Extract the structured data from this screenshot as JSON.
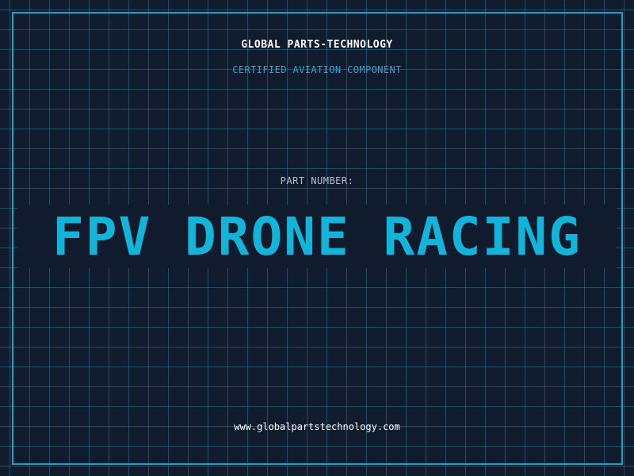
{
  "header": {
    "company": "GLOBAL PARTS-TECHNOLOGY",
    "certification": "CERTIFIED AVIATION COMPONENT"
  },
  "part": {
    "label": "PART NUMBER:",
    "number": "FPV DRONE RACING"
  },
  "footer": {
    "website": "www.globalpartstechnology.com"
  },
  "colors": {
    "background": "#111b2e",
    "grid": "#28789a",
    "accent": "#12b5d9",
    "frame": "#1aa3c4",
    "label": "#b5bfcc",
    "text": "#ffffff"
  }
}
